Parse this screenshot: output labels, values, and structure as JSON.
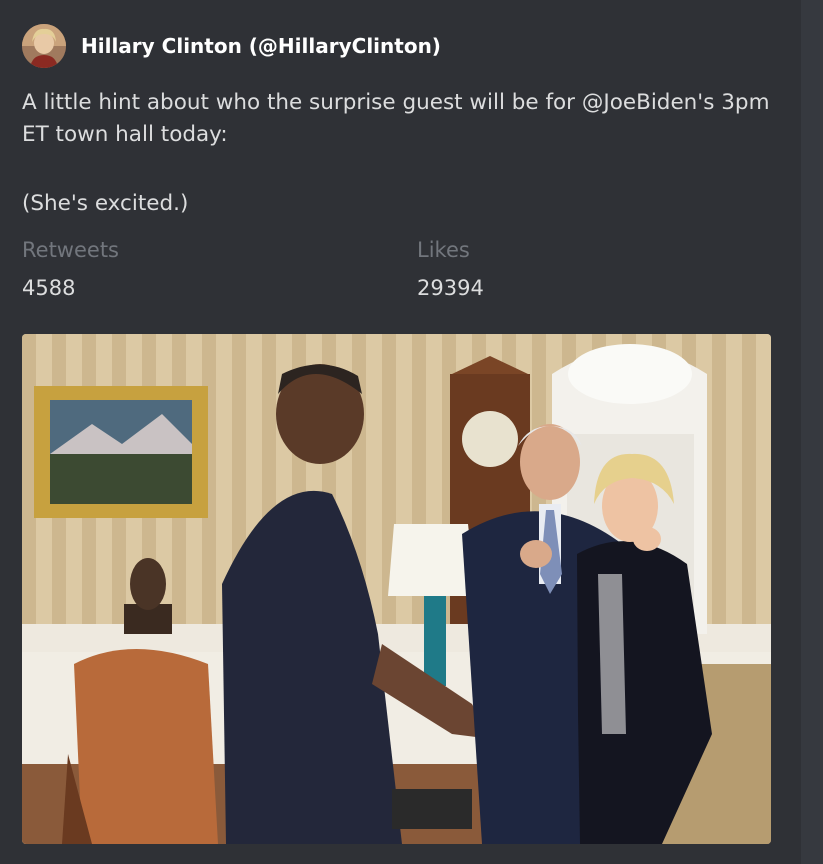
{
  "embed": {
    "author": {
      "name": "Hillary Clinton (@HillaryClinton)",
      "avatar_icon": "user-avatar-photo"
    },
    "description": {
      "line1": "A little hint about who the surprise guest will be for @JoeBiden's 3pm ET town hall today:",
      "line2": "(She's excited.)"
    },
    "fields": [
      {
        "name": "Retweets",
        "value": "4588"
      },
      {
        "name": "Likes",
        "value": "29394"
      }
    ],
    "image": {
      "alt_icon": "embedded-photo"
    }
  },
  "colors": {
    "background": "#2f3136",
    "side_strip": "#36393f",
    "author_text": "#ffffff",
    "body_text": "#dcddde",
    "field_name": "#72767d"
  }
}
